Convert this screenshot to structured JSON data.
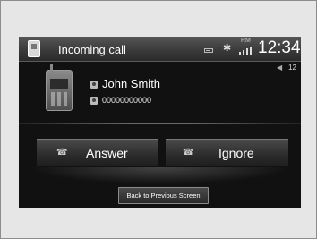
{
  "status_bar": {
    "title": "Incoming call",
    "rm_label": "RM",
    "clock": "12:34"
  },
  "volume": "12",
  "caller": {
    "name": "John Smith",
    "number": "00000000000"
  },
  "buttons": {
    "answer": "Answer",
    "ignore": "Ignore",
    "back": "Back to Previous Screen"
  },
  "icons": {
    "status": [
      "phone-icon",
      "battery-icon",
      "bluetooth-icon",
      "signal-icon"
    ],
    "speaker": "speaker-icon",
    "answer": "handset-off-hook-icon",
    "ignore": "handset-hang-up-icon"
  }
}
